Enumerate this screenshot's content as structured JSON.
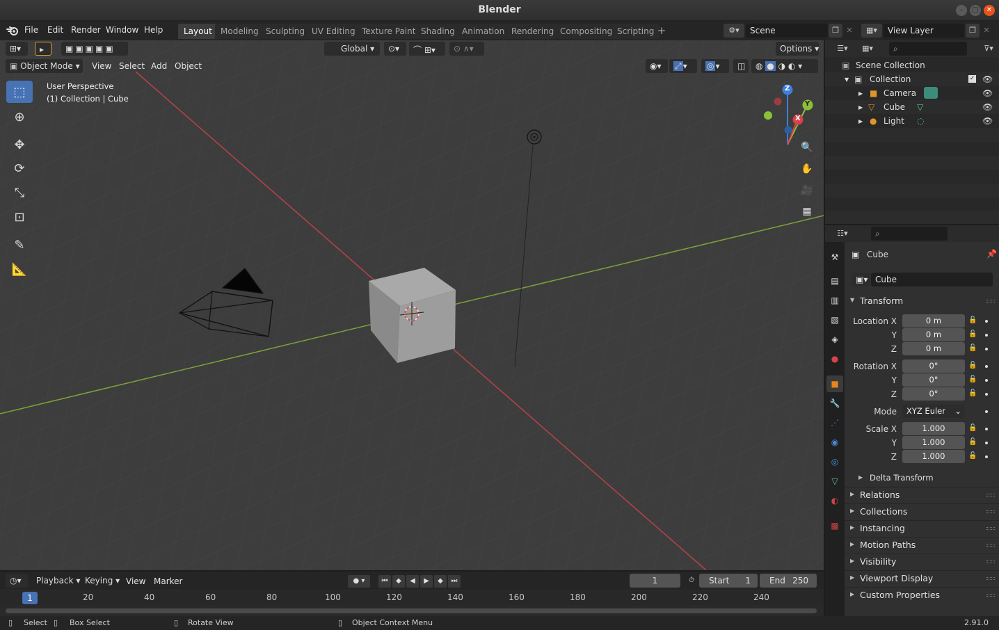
{
  "window": {
    "title": "Blender",
    "min_glyph": "–",
    "max_glyph": "□",
    "close_glyph": "✕"
  },
  "menu": {
    "file": "File",
    "edit": "Edit",
    "render": "Render",
    "window": "Window",
    "help": "Help"
  },
  "workspaces": [
    {
      "label": "Layout",
      "active": true
    },
    {
      "label": "Modeling"
    },
    {
      "label": "Sculpting"
    },
    {
      "label": "UV Editing"
    },
    {
      "label": "Texture Paint"
    },
    {
      "label": "Shading"
    },
    {
      "label": "Animation"
    },
    {
      "label": "Rendering"
    },
    {
      "label": "Compositing"
    },
    {
      "label": "Scripting"
    }
  ],
  "workspace_add": "+",
  "scene": {
    "name": "Scene",
    "view_layer": "View Layer"
  },
  "viewport": {
    "transform_orientation": "Global",
    "options_label": "Options",
    "mode": "Object Mode",
    "menus": {
      "view": "View",
      "select": "Select",
      "add": "Add",
      "object": "Object"
    },
    "overlay_line1": "User Perspective",
    "overlay_line2": "(1) Collection | Cube",
    "gizmo": {
      "x": "X",
      "y": "Y",
      "z": "Z"
    }
  },
  "timeline": {
    "playback": "Playback",
    "keying": "Keying",
    "view": "View",
    "marker": "Marker",
    "current_frame": "1",
    "start_label": "Start",
    "start": "1",
    "end_label": "End",
    "end": "250",
    "ruler_current": "1",
    "ticks": [
      "20",
      "40",
      "60",
      "80",
      "100",
      "120",
      "140",
      "160",
      "180",
      "200",
      "220",
      "240"
    ]
  },
  "status": {
    "select": "Select",
    "box_select": "Box Select",
    "rotate_view": "Rotate View",
    "context_menu": "Object Context Menu",
    "version": "2.91.0"
  },
  "outliner": {
    "scene_collection": "Scene Collection",
    "collection": "Collection",
    "items": [
      {
        "label": "Camera"
      },
      {
        "label": "Cube"
      },
      {
        "label": "Light"
      }
    ]
  },
  "properties": {
    "object_name": "Cube",
    "object_name_field": "Cube",
    "transform_label": "Transform",
    "location_label": "Location X",
    "rotation_label": "Rotation X",
    "scale_label": "Scale X",
    "y_label": "Y",
    "z_label": "Z",
    "mode_label": "Mode",
    "location": {
      "x": "0 m",
      "y": "0 m",
      "z": "0 m"
    },
    "rotation": {
      "x": "0°",
      "y": "0°",
      "z": "0°"
    },
    "rotation_mode": "XYZ Euler",
    "scale": {
      "x": "1.000",
      "y": "1.000",
      "z": "1.000"
    },
    "delta_transform": "Delta Transform",
    "panels": [
      "Relations",
      "Collections",
      "Instancing",
      "Motion Paths",
      "Visibility",
      "Viewport Display",
      "Custom Properties"
    ]
  },
  "colors": {
    "accent": "#4772b3",
    "x_axis": "#d8404a",
    "y_axis": "#8bbf3a",
    "z_axis": "#3f7fdc",
    "active_tab": "#e9541e"
  }
}
